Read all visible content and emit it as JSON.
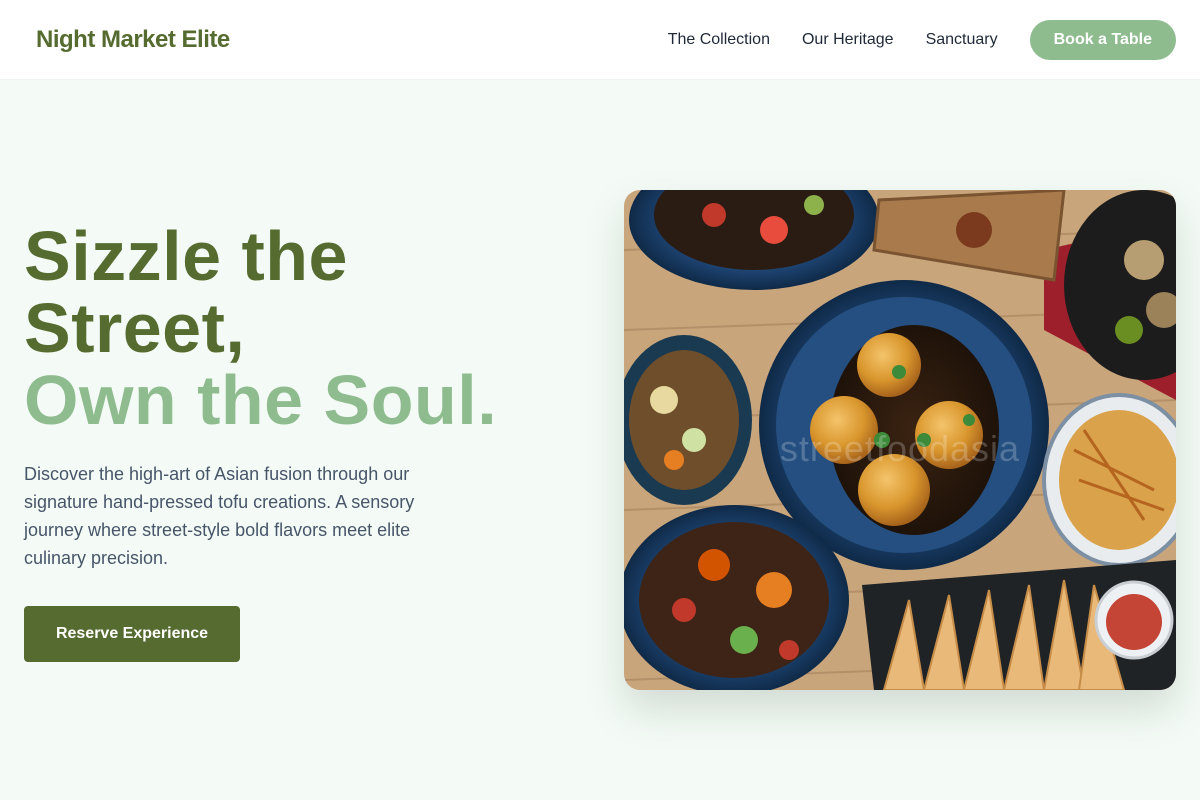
{
  "brand": {
    "name": "Night Market Elite"
  },
  "nav": {
    "links": [
      "The Collection",
      "Our Heritage",
      "Sanctuary"
    ],
    "cta": "Book a Table"
  },
  "hero": {
    "headline_line1": "Sizzle the",
    "headline_line2": "Street,",
    "headline_accent": "Own the Soul.",
    "description": "Discover the high-art of Asian fusion through our signature hand-pressed tofu creations. A sensory journey where street-style bold flavors meet elite culinary precision.",
    "cta": "Reserve Experience",
    "image_watermark": "streetfoodasia"
  },
  "colors": {
    "brand_dark": "#556b2f",
    "brand_light": "#8fbc8f",
    "background": "#f4fbf6"
  },
  "icons": [
    "food-photo"
  ]
}
